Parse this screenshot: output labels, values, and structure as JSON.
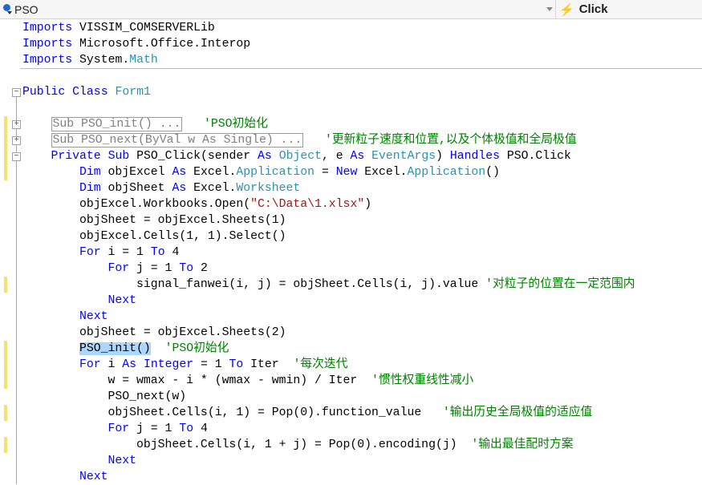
{
  "toolbar": {
    "class_dropdown": "PSO",
    "method_dropdown": "Click",
    "class_icon": "class-icon",
    "method_icon": "event-lightning-icon"
  },
  "colors": {
    "keyword": "#0000ff",
    "type": "#2b91af",
    "string": "#a31515",
    "comment": "#008000",
    "highlight": "#add6ff",
    "change_marker": "#f5e16b"
  },
  "lines": [
    {
      "row": 0,
      "indent": 0,
      "tokens": [
        {
          "t": "Imports",
          "c": "kw"
        },
        {
          "t": " VISSIM_COMSERVERLib"
        }
      ]
    },
    {
      "row": 1,
      "indent": 0,
      "tokens": [
        {
          "t": "Imports",
          "c": "kw"
        },
        {
          "t": " Microsoft.Office.Interop"
        }
      ]
    },
    {
      "row": 2,
      "indent": 0,
      "tokens": [
        {
          "t": "Imports",
          "c": "kw"
        },
        {
          "t": " System."
        },
        {
          "t": "Math",
          "c": "ty"
        }
      ]
    },
    {
      "row": 4,
      "indent": 0,
      "tokens": [
        {
          "t": "Public",
          "c": "kw"
        },
        {
          "t": " "
        },
        {
          "t": "Class",
          "c": "kw"
        },
        {
          "t": " "
        },
        {
          "t": "Form1",
          "c": "ty"
        }
      ]
    },
    {
      "row": 6,
      "indent": 1,
      "tokens": [
        {
          "t": "Sub PSO_init() ...",
          "c": "collapsed"
        },
        {
          "t": "   "
        },
        {
          "t": "'PSO初始化",
          "c": "cm"
        }
      ]
    },
    {
      "row": 7,
      "indent": 1,
      "tokens": [
        {
          "t": "Sub PSO_next(ByVal w As Single) ...",
          "c": "collapsed"
        },
        {
          "t": "   "
        },
        {
          "t": "'更新粒子速度和位置,以及个体极值和全局极值",
          "c": "cm"
        }
      ]
    },
    {
      "row": 8,
      "indent": 1,
      "tokens": [
        {
          "t": "Private",
          "c": "kw"
        },
        {
          "t": " "
        },
        {
          "t": "Sub",
          "c": "kw"
        },
        {
          "t": " PSO_Click(sender "
        },
        {
          "t": "As",
          "c": "kw"
        },
        {
          "t": " "
        },
        {
          "t": "Object",
          "c": "ty"
        },
        {
          "t": ", e "
        },
        {
          "t": "As",
          "c": "kw"
        },
        {
          "t": " "
        },
        {
          "t": "EventArgs",
          "c": "ty"
        },
        {
          "t": ") "
        },
        {
          "t": "Handles",
          "c": "kw"
        },
        {
          "t": " PSO.Click"
        }
      ]
    },
    {
      "row": 9,
      "indent": 2,
      "tokens": [
        {
          "t": "Dim",
          "c": "kw"
        },
        {
          "t": " objExcel "
        },
        {
          "t": "As",
          "c": "kw"
        },
        {
          "t": " Excel."
        },
        {
          "t": "Application",
          "c": "ty"
        },
        {
          "t": " = "
        },
        {
          "t": "New",
          "c": "kw"
        },
        {
          "t": " Excel."
        },
        {
          "t": "Application",
          "c": "ty"
        },
        {
          "t": "()"
        }
      ]
    },
    {
      "row": 10,
      "indent": 2,
      "tokens": [
        {
          "t": "Dim",
          "c": "kw"
        },
        {
          "t": " objSheet "
        },
        {
          "t": "As",
          "c": "kw"
        },
        {
          "t": " Excel."
        },
        {
          "t": "Worksheet",
          "c": "ty"
        }
      ]
    },
    {
      "row": 11,
      "indent": 2,
      "tokens": [
        {
          "t": "objExcel.Workbooks.Open("
        },
        {
          "t": "\"C:\\Data\\1.xlsx\"",
          "c": "str"
        },
        {
          "t": ")"
        }
      ]
    },
    {
      "row": 12,
      "indent": 2,
      "tokens": [
        {
          "t": "objSheet = objExcel.Sheets(1)"
        }
      ]
    },
    {
      "row": 13,
      "indent": 2,
      "tokens": [
        {
          "t": "objExcel.Cells(1, 1).Select()"
        }
      ]
    },
    {
      "row": 14,
      "indent": 2,
      "tokens": [
        {
          "t": "For",
          "c": "kw"
        },
        {
          "t": " i = 1 "
        },
        {
          "t": "To",
          "c": "kw"
        },
        {
          "t": " 4"
        }
      ]
    },
    {
      "row": 15,
      "indent": 3,
      "tokens": [
        {
          "t": "For",
          "c": "kw"
        },
        {
          "t": " j = 1 "
        },
        {
          "t": "To",
          "c": "kw"
        },
        {
          "t": " 2"
        }
      ]
    },
    {
      "row": 16,
      "indent": 4,
      "tokens": [
        {
          "t": "signal_fanwei(i, j) = objSheet.Cells(i, j).value "
        },
        {
          "t": "'对粒子的位置在一定范围内",
          "c": "cm"
        }
      ]
    },
    {
      "row": 17,
      "indent": 3,
      "tokens": [
        {
          "t": "Next",
          "c": "kw"
        }
      ]
    },
    {
      "row": 18,
      "indent": 2,
      "tokens": [
        {
          "t": "Next",
          "c": "kw"
        }
      ]
    },
    {
      "row": 19,
      "indent": 2,
      "tokens": [
        {
          "t": "objSheet = objExcel.Sheets(2)"
        }
      ]
    },
    {
      "row": 20,
      "indent": 2,
      "tokens": [
        {
          "t": "PSO_init()",
          "c": "hl"
        },
        {
          "t": "  "
        },
        {
          "t": "'PSO初始化",
          "c": "cm"
        }
      ]
    },
    {
      "row": 21,
      "indent": 2,
      "tokens": [
        {
          "t": "For",
          "c": "kw"
        },
        {
          "t": " i "
        },
        {
          "t": "As",
          "c": "kw"
        },
        {
          "t": " "
        },
        {
          "t": "Integer",
          "c": "kw"
        },
        {
          "t": " = 1 "
        },
        {
          "t": "To",
          "c": "kw"
        },
        {
          "t": " Iter  "
        },
        {
          "t": "'每次迭代",
          "c": "cm"
        }
      ]
    },
    {
      "row": 22,
      "indent": 3,
      "tokens": [
        {
          "t": "w = wmax - i * (wmax - wmin) / Iter  "
        },
        {
          "t": "'惯性权重线性减小",
          "c": "cm"
        }
      ]
    },
    {
      "row": 23,
      "indent": 3,
      "tokens": [
        {
          "t": "PSO_next(w)"
        }
      ]
    },
    {
      "row": 24,
      "indent": 3,
      "tokens": [
        {
          "t": "objSheet.Cells(i, 1) = Pop(0).function_value   "
        },
        {
          "t": "'输出历史全局极值的适应值",
          "c": "cm"
        }
      ]
    },
    {
      "row": 25,
      "indent": 3,
      "tokens": [
        {
          "t": "For",
          "c": "kw"
        },
        {
          "t": " j = 1 "
        },
        {
          "t": "To",
          "c": "kw"
        },
        {
          "t": " 4"
        }
      ]
    },
    {
      "row": 26,
      "indent": 4,
      "tokens": [
        {
          "t": "objSheet.Cells(i, 1 + j) = Pop(0).encoding(j)  "
        },
        {
          "t": "'输出最佳配时方案",
          "c": "cm"
        }
      ]
    },
    {
      "row": 27,
      "indent": 3,
      "tokens": [
        {
          "t": "Next",
          "c": "kw"
        }
      ]
    },
    {
      "row": 28,
      "indent": 2,
      "tokens": [
        {
          "t": "Next",
          "c": "kw"
        }
      ]
    }
  ],
  "change_markers": [
    [
      6,
      9
    ],
    [
      16,
      16
    ],
    [
      20,
      22
    ],
    [
      24,
      24
    ],
    [
      26,
      26
    ]
  ],
  "outline": [
    {
      "row": 4,
      "symbol": "−"
    },
    {
      "row": 6,
      "symbol": "+"
    },
    {
      "row": 7,
      "symbol": "+"
    },
    {
      "row": 8,
      "symbol": "−"
    }
  ]
}
